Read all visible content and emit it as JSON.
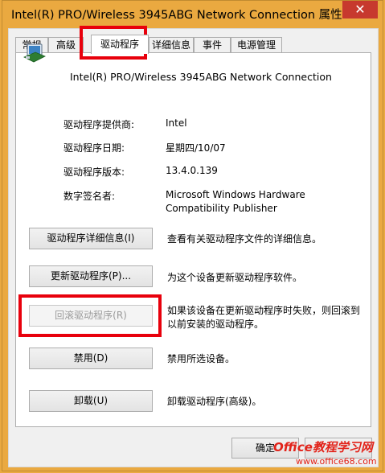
{
  "window": {
    "title": "Intel(R) PRO/Wireless 3945ABG Network Connection 属性",
    "close_glyph": "✕"
  },
  "tabs": [
    {
      "label": "常规"
    },
    {
      "label": "高级"
    },
    {
      "label": "驱动程序"
    },
    {
      "label": "详细信息"
    },
    {
      "label": "事件"
    },
    {
      "label": "电源管理"
    }
  ],
  "device": {
    "name": "Intel(R) PRO/Wireless 3945ABG Network Connection",
    "icon": "network-adapter-icon"
  },
  "driver_info": {
    "provider_label": "驱动程序提供商:",
    "provider_value": "Intel",
    "date_label": "驱动程序日期:",
    "date_value": "星期四/10/07",
    "version_label": "驱动程序版本:",
    "version_value": "13.4.0.139",
    "signer_label": "数字签名者:",
    "signer_value_line1": "Microsoft Windows Hardware",
    "signer_value_line2": "Compatibility Publisher"
  },
  "actions": {
    "details_button": "驱动程序详细信息(I)",
    "details_desc": "查看有关驱动程序文件的详细信息。",
    "update_button": "更新驱动程序(P)...",
    "update_desc": "为这个设备更新驱动程序软件。",
    "rollback_button": "回滚驱动程序(R)",
    "rollback_desc_line1": "如果该设备在更新驱动程序时失败，则回滚到",
    "rollback_desc_line2": "以前安装的驱动程序。",
    "disable_button": "禁用(D)",
    "disable_desc": "禁用所选设备。",
    "uninstall_button": "卸载(U)",
    "uninstall_desc": "卸载驱动程序(高级)。"
  },
  "footer": {
    "ok_button": "确定"
  },
  "watermark": {
    "line1": "Office教程学习网",
    "line2": "www.office68.com"
  },
  "colors": {
    "title_bar": "#eaa940",
    "close_button": "#c7392e",
    "highlight": "#e8000c"
  }
}
